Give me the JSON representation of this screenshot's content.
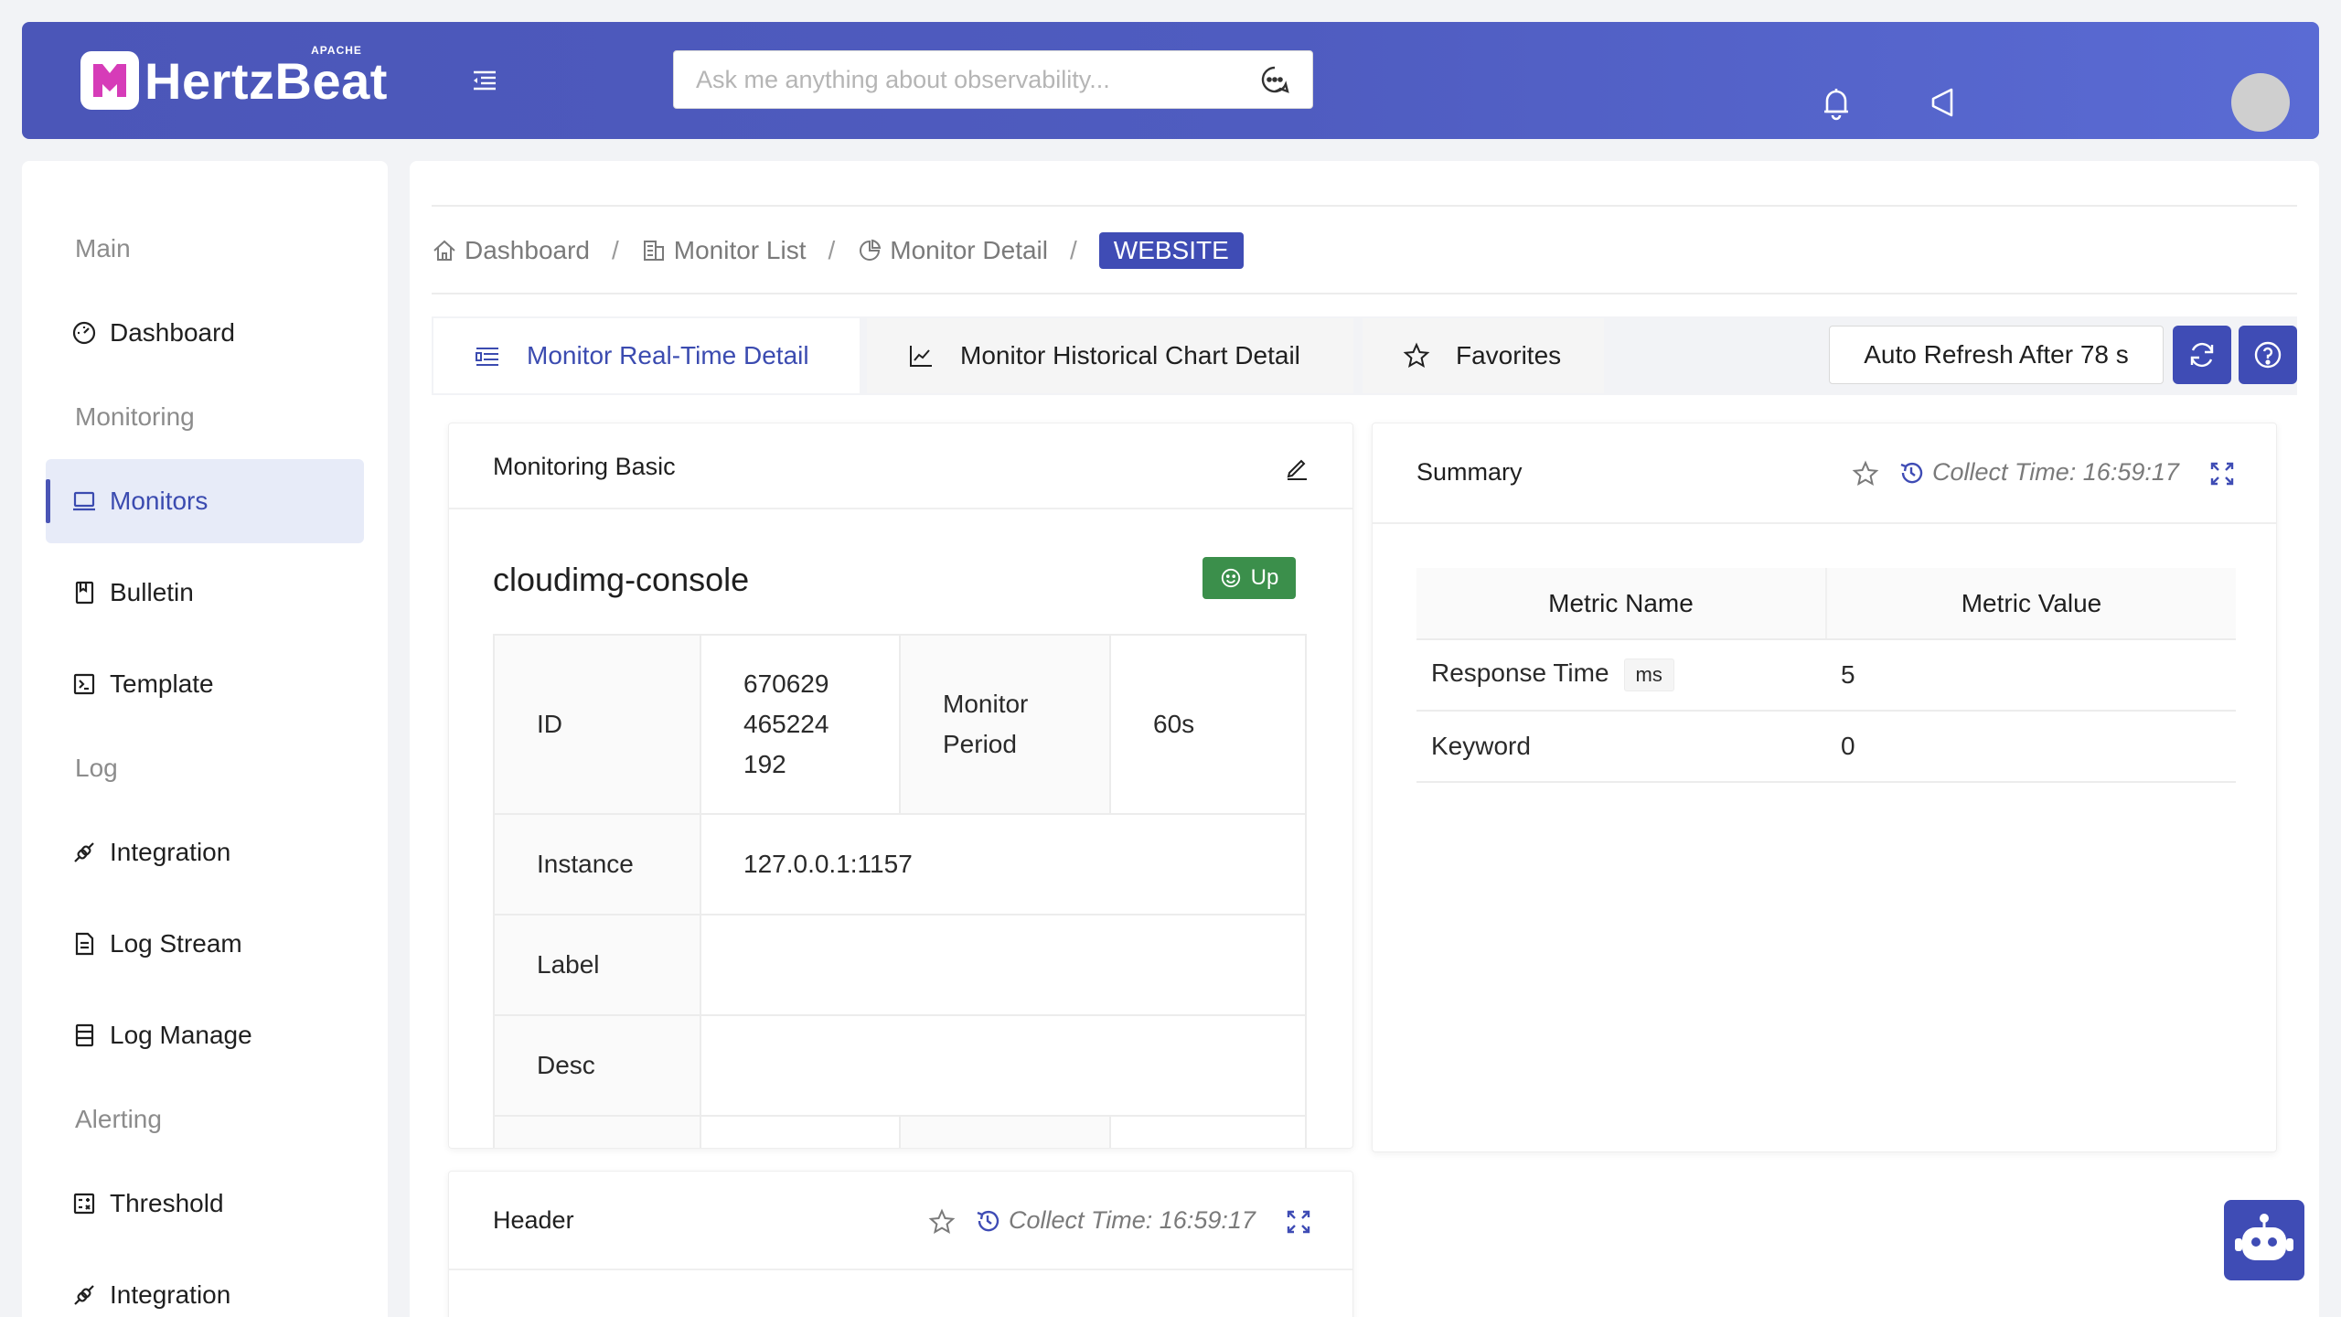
{
  "header": {
    "logo_text": "HertzBeat",
    "logo_superscript": "APACHE",
    "search_placeholder": "Ask me anything about observability...",
    "icons": [
      "menu-fold-icon",
      "chat-icon",
      "bell-icon",
      "notification-icon",
      "avatar"
    ]
  },
  "sidebar": {
    "groups": {
      "main": "Main",
      "monitoring": "Monitoring",
      "log": "Log",
      "alerting": "Alerting"
    },
    "items": [
      {
        "label": "Dashboard",
        "icon": "dashboard-icon"
      },
      {
        "label": "Monitors",
        "icon": "laptop-icon",
        "active": true
      },
      {
        "label": "Bulletin",
        "icon": "book-icon"
      },
      {
        "label": "Template",
        "icon": "code-icon"
      },
      {
        "label": "Integration",
        "icon": "api-icon"
      },
      {
        "label": "Log Stream",
        "icon": "file-icon"
      },
      {
        "label": "Log Manage",
        "icon": "database-icon"
      },
      {
        "label": "Threshold",
        "icon": "calculator-icon"
      },
      {
        "label": "Integration",
        "icon": "api-icon"
      }
    ]
  },
  "breadcrumb": {
    "items": [
      "Dashboard",
      "Monitor List",
      "Monitor Detail"
    ],
    "separator": "/",
    "current": "WEBSITE"
  },
  "tabs": [
    {
      "label": "Monitor Real-Time Detail",
      "active": true
    },
    {
      "label": "Monitor Historical Chart Detail"
    },
    {
      "label": "Favorites"
    }
  ],
  "toolbar": {
    "auto_refresh": "Auto Refresh After 78 s"
  },
  "basic_card": {
    "title": "Monitoring Basic",
    "monitor_name": "cloudimg-console",
    "status": "Up",
    "rows": {
      "id_label": "ID",
      "id_value_lines": [
        "670629",
        "465224",
        "192"
      ],
      "period_label_lines": [
        "Monitor",
        "Period"
      ],
      "period_value": "60s",
      "instance_label": "Instance",
      "instance_value": "127.0.0.1:1157",
      "label_label": "Label",
      "label_value": "",
      "desc_label": "Desc",
      "desc_value": ""
    }
  },
  "summary_card": {
    "title": "Summary",
    "collect_time": "Collect Time: 16:59:17",
    "columns": [
      "Metric Name",
      "Metric Value"
    ],
    "rows": [
      {
        "name": "Response Time",
        "unit": "ms",
        "value": "5"
      },
      {
        "name": "Keyword",
        "unit": "",
        "value": "0"
      }
    ]
  },
  "header_card": {
    "title": "Header",
    "collect_time": "Collect Time: 16:59:17"
  },
  "colors": {
    "primary": "#3f4cb5",
    "header_gradient_start": "#4b56b8",
    "status_up": "#3b8f4b",
    "page_bg": "#f2f3f6"
  }
}
